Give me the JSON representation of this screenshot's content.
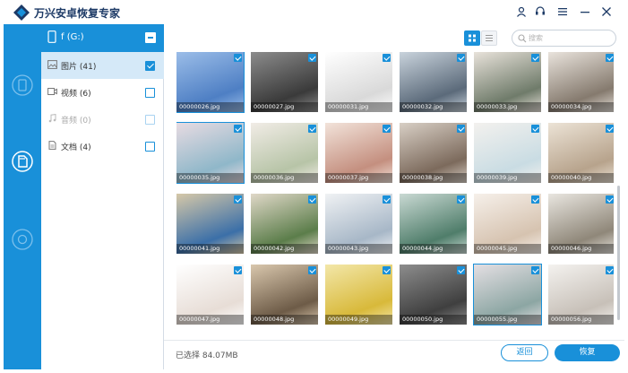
{
  "app": {
    "title": "万兴安卓恢复专家"
  },
  "colors": {
    "accent": "#1990d9",
    "sidebar": "#1990d9",
    "active_row": "#d5e9f8"
  },
  "window_controls": [
    "user-icon",
    "support-icon",
    "menu-icon",
    "minimize-icon",
    "close-icon"
  ],
  "nav": {
    "icons": [
      "phone-recover-icon",
      "sd-card-recover-icon",
      "repair-icon"
    ]
  },
  "folder_panel": {
    "drive_label": "f (G:)",
    "categories": [
      {
        "label": "图片 (41)",
        "icon": "image-icon",
        "checked": true,
        "active": true
      },
      {
        "label": "视频 (6)",
        "icon": "video-icon",
        "checked": false,
        "active": false
      },
      {
        "label": "音频 (0)",
        "icon": "audio-icon",
        "checked": false,
        "active": false
      },
      {
        "label": "文档 (4)",
        "icon": "document-icon",
        "checked": false,
        "active": false
      }
    ]
  },
  "toolbar": {
    "search_placeholder": "搜索"
  },
  "grid": {
    "items": [
      {
        "name": "00000026.jpg",
        "selected": true
      },
      {
        "name": "00000027.jpg",
        "selected": false
      },
      {
        "name": "00000031.jpg",
        "selected": false
      },
      {
        "name": "00000032.jpg",
        "selected": false
      },
      {
        "name": "00000033.jpg",
        "selected": false
      },
      {
        "name": "00000034.jpg",
        "selected": false
      },
      {
        "name": "00000035.jpg",
        "selected": true
      },
      {
        "name": "00000036.jpg",
        "selected": false
      },
      {
        "name": "00000037.jpg",
        "selected": false
      },
      {
        "name": "00000038.jpg",
        "selected": false
      },
      {
        "name": "00000039.jpg",
        "selected": false
      },
      {
        "name": "00000040.jpg",
        "selected": false
      },
      {
        "name": "00000041.jpg",
        "selected": false
      },
      {
        "name": "00000042.jpg",
        "selected": false
      },
      {
        "name": "00000043.jpg",
        "selected": false
      },
      {
        "name": "00000044.jpg",
        "selected": false
      },
      {
        "name": "00000045.jpg",
        "selected": false
      },
      {
        "name": "00000046.jpg",
        "selected": false
      },
      {
        "name": "00000047.jpg",
        "selected": false
      },
      {
        "name": "00000048.jpg",
        "selected": false
      },
      {
        "name": "00000049.jpg",
        "selected": false
      },
      {
        "name": "00000050.jpg",
        "selected": false
      },
      {
        "name": "00000055.jpg",
        "selected": true
      },
      {
        "name": "00000056.jpg",
        "selected": false
      }
    ]
  },
  "footer": {
    "selected_text": "已选择 84.07MB",
    "back_label": "返回",
    "recover_label": "恢复"
  }
}
